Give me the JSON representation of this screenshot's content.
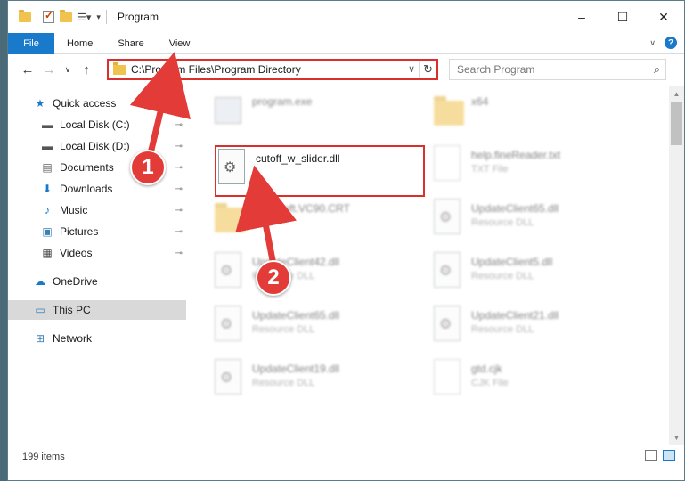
{
  "window": {
    "title": "Program",
    "controls": {
      "minimize": "–",
      "maximize": "☐",
      "close": "✕"
    }
  },
  "ribbon": {
    "tabs": [
      "File",
      "Home",
      "Share",
      "View"
    ],
    "help": "?",
    "expand": "∨"
  },
  "nav": {
    "back": "←",
    "forward": "→",
    "recent": "∨",
    "up": "↑"
  },
  "address": {
    "path": "C:\\Program Files\\Program Directory",
    "chevron": "∨",
    "refresh": "↻"
  },
  "search": {
    "placeholder": "Search Program",
    "icon": "⌕"
  },
  "sidebar": {
    "items": [
      {
        "label": "Quick access",
        "icon": "star-icon",
        "glyph": "★",
        "pinned": false
      },
      {
        "label": "Local Disk (C:)",
        "icon": "drive-icon",
        "glyph": "▬",
        "pinned": true
      },
      {
        "label": "Local Disk (D:)",
        "icon": "drive-icon",
        "glyph": "▬",
        "pinned": true
      },
      {
        "label": "Documents",
        "icon": "documents-icon",
        "glyph": "▤",
        "pinned": true
      },
      {
        "label": "Downloads",
        "icon": "download-icon",
        "glyph": "⬇",
        "pinned": true
      },
      {
        "label": "Music",
        "icon": "music-icon",
        "glyph": "♪",
        "pinned": true
      },
      {
        "label": "Pictures",
        "icon": "pictures-icon",
        "glyph": "▣",
        "pinned": true
      },
      {
        "label": "Videos",
        "icon": "videos-icon",
        "glyph": "▦",
        "pinned": true
      },
      {
        "label": "OneDrive",
        "icon": "cloud-icon",
        "glyph": "☁",
        "pinned": false
      },
      {
        "label": "This PC",
        "icon": "computer-icon",
        "glyph": "▭",
        "pinned": false
      },
      {
        "label": "Network",
        "icon": "network-icon",
        "glyph": "⊞",
        "pinned": false
      }
    ],
    "pin_glyph": "📌"
  },
  "files": {
    "items": [
      {
        "name": "program.exe",
        "type": "",
        "kind": "exe"
      },
      {
        "name": "x64",
        "type": "",
        "kind": "folder"
      },
      {
        "name": "cutoff_w_slider.dll",
        "type": "",
        "kind": "dll"
      },
      {
        "name": "help.fineReader.txt",
        "type": "TXT File",
        "kind": "txt"
      },
      {
        "name": "Microsoft.VC90.CRT",
        "type": "",
        "kind": "folder"
      },
      {
        "name": "UpdateClient65.dll",
        "type": "Resource DLL",
        "kind": "dll"
      },
      {
        "name": "UpdateClient42.dll",
        "type": "Resource DLL",
        "kind": "dll"
      },
      {
        "name": "UpdateClient5.dll",
        "type": "Resource DLL",
        "kind": "dll"
      },
      {
        "name": "UpdateClient65.dll",
        "type": "Resource DLL",
        "kind": "dll"
      },
      {
        "name": "UpdateClient21.dll",
        "type": "Resource DLL",
        "kind": "dll"
      },
      {
        "name": "UpdateClient19.dll",
        "type": "Resource DLL",
        "kind": "dll"
      },
      {
        "name": "gtd.cjk",
        "type": "CJK File",
        "kind": "txt"
      }
    ]
  },
  "status": {
    "item_count": "199 items"
  },
  "callouts": {
    "step1": "1",
    "step2": "2",
    "color": "#e23b38"
  }
}
